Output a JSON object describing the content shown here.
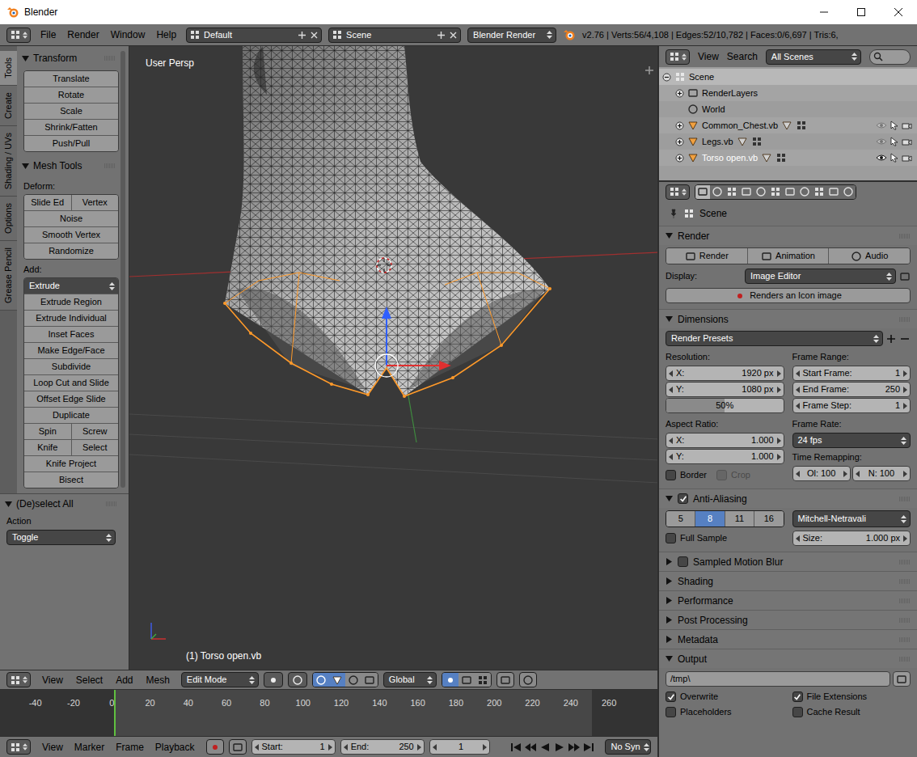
{
  "window": {
    "title": "Blender"
  },
  "info_header": {
    "menus": [
      "File",
      "Render",
      "Window",
      "Help"
    ],
    "layout": "Default",
    "scene": "Scene",
    "engine": "Blender Render",
    "stats": "v2.76 | Verts:56/4,108 | Edges:52/10,782 | Faces:0/6,697 | Tris:6,"
  },
  "tool_shelf": {
    "tabs": [
      {
        "label": "Tools",
        "selected": true
      },
      {
        "label": "Create",
        "selected": false
      },
      {
        "label": "Shading / UVs",
        "selected": false
      },
      {
        "label": "Options",
        "selected": false
      },
      {
        "label": "Grease Pencil",
        "selected": false
      }
    ],
    "panels": [
      {
        "title": "Transform",
        "expanded": true,
        "groups": [
          {
            "label": "",
            "rows": [
              {
                "kind": "button",
                "buttons": [
                  "Translate"
                ]
              },
              {
                "kind": "button",
                "buttons": [
                  "Rotate"
                ]
              },
              {
                "kind": "button",
                "buttons": [
                  "Scale"
                ]
              },
              {
                "kind": "button",
                "buttons": [
                  "Shrink/Fatten"
                ]
              },
              {
                "kind": "button",
                "buttons": [
                  "Push/Pull"
                ]
              }
            ]
          }
        ]
      },
      {
        "title": "Mesh Tools",
        "expanded": true,
        "groups": [
          {
            "label": "Deform:",
            "rows": [
              {
                "kind": "button",
                "buttons": [
                  "Slide Ed",
                  "Vertex"
                ]
              },
              {
                "kind": "button",
                "buttons": [
                  "Noise"
                ]
              },
              {
                "kind": "button",
                "buttons": [
                  "Smooth Vertex"
                ]
              },
              {
                "kind": "button",
                "buttons": [
                  "Randomize"
                ]
              }
            ]
          },
          {
            "label": "Add:",
            "rows": [
              {
                "kind": "menu",
                "buttons": [
                  "Extrude"
                ]
              },
              {
                "kind": "button",
                "buttons": [
                  "Extrude Region"
                ]
              },
              {
                "kind": "button",
                "buttons": [
                  "Extrude Individual"
                ]
              },
              {
                "kind": "button",
                "buttons": [
                  "Inset Faces"
                ]
              },
              {
                "kind": "button",
                "buttons": [
                  "Make Edge/Face"
                ]
              },
              {
                "kind": "button",
                "buttons": [
                  "Subdivide"
                ]
              },
              {
                "kind": "button",
                "buttons": [
                  "Loop Cut and Slide"
                ]
              },
              {
                "kind": "button",
                "buttons": [
                  "Offset Edge Slide"
                ]
              },
              {
                "kind": "button",
                "buttons": [
                  "Duplicate"
                ]
              },
              {
                "kind": "button",
                "buttons": [
                  "Spin",
                  "Screw"
                ]
              },
              {
                "kind": "button",
                "buttons": [
                  "Knife",
                  "Select"
                ]
              },
              {
                "kind": "button",
                "buttons": [
                  "Knife Project"
                ]
              },
              {
                "kind": "button",
                "buttons": [
                  "Bisect"
                ]
              }
            ]
          }
        ]
      }
    ],
    "operator": {
      "title": "(De)select All",
      "expanded": true,
      "label": "Action",
      "value": "Toggle"
    }
  },
  "viewport": {
    "view_name": "User Persp",
    "object_label": "(1) Torso open.vb"
  },
  "view3d_header": {
    "menus": [
      "View",
      "Select",
      "Add",
      "Mesh"
    ],
    "mode": "Edit Mode",
    "orientation": "Global"
  },
  "timeline": {
    "ruler": [
      "-40",
      "-20",
      "0",
      "20",
      "40",
      "60",
      "80",
      "100",
      "120",
      "140",
      "160",
      "180",
      "200",
      "220",
      "240",
      "260"
    ],
    "menus": [
      "View",
      "Marker",
      "Frame",
      "Playback"
    ],
    "start": {
      "label": "Start:",
      "value": "1"
    },
    "end": {
      "label": "End:",
      "value": "250"
    },
    "frame": "1",
    "sync": "No Syn"
  },
  "outliner": {
    "menus": [
      "View",
      "Search"
    ],
    "filter": "All Scenes",
    "items": [
      {
        "name": "Scene",
        "depth": 0,
        "kind": "scene",
        "expandable": true,
        "expanded": true,
        "selected": true,
        "active": false,
        "visible": true
      },
      {
        "name": "RenderLayers",
        "depth": 1,
        "kind": "renderlayers",
        "expandable": true,
        "expanded": false,
        "selected": false,
        "active": false,
        "visible": true
      },
      {
        "name": "World",
        "depth": 1,
        "kind": "world",
        "expandable": false,
        "expanded": false,
        "selected": false,
        "active": false,
        "visible": true
      },
      {
        "name": "Common_Chest.vb",
        "depth": 1,
        "kind": "object",
        "expandable": true,
        "expanded": false,
        "selected": false,
        "active": false,
        "visible": false
      },
      {
        "name": "Legs.vb",
        "depth": 1,
        "kind": "object",
        "expandable": true,
        "expanded": false,
        "selected": false,
        "active": false,
        "visible": false
      },
      {
        "name": "Torso open.vb",
        "depth": 1,
        "kind": "object",
        "expandable": true,
        "expanded": false,
        "selected": false,
        "active": true,
        "visible": true
      }
    ]
  },
  "properties": {
    "tabs": [
      {
        "selected": true
      },
      {
        "selected": false
      },
      {
        "selected": false
      },
      {
        "selected": false
      },
      {
        "selected": false
      },
      {
        "selected": false
      },
      {
        "selected": false
      },
      {
        "selected": false
      },
      {
        "selected": false
      },
      {
        "selected": false
      },
      {
        "selected": false
      }
    ],
    "context": "Scene",
    "render": {
      "title": "Render",
      "expanded": true,
      "buttons": [
        "Render",
        "Animation",
        "Audio"
      ],
      "display_label": "Display:",
      "display": "Image Editor",
      "icon_button": "Renders an Icon image"
    },
    "dimensions": {
      "title": "Dimensions",
      "expanded": true,
      "presets": "Render Presets",
      "resolution_label": "Resolution:",
      "resolution": [
        {
          "label": "X:",
          "value": "1920 px"
        },
        {
          "label": "Y:",
          "value": "1080 px"
        }
      ],
      "percentage": {
        "value": "50%",
        "level": 0.5
      },
      "aspect_label": "Aspect Ratio:",
      "aspect": [
        {
          "label": "X:",
          "value": "1.000"
        },
        {
          "label": "Y:",
          "value": "1.000"
        }
      ],
      "border": {
        "label": "Border",
        "checked": false,
        "disabled": false
      },
      "crop": {
        "label": "Crop",
        "checked": false,
        "disabled": true
      },
      "frame_range_label": "Frame Range:",
      "frame_range": [
        {
          "label": "Start Frame:",
          "value": "1"
        },
        {
          "label": "End Frame:",
          "value": "250"
        },
        {
          "label": "Frame Step:",
          "value": "1"
        }
      ],
      "frame_rate_label": "Frame Rate:",
      "frame_rate": "24 fps",
      "remap_label": "Time Remapping:",
      "remap": [
        {
          "label": "Ol:",
          "value": "100"
        },
        {
          "label": "N:",
          "value": "100"
        }
      ]
    },
    "anti_aliasing": {
      "title": "Anti-Aliasing",
      "expanded": true,
      "enabled": true,
      "samples": [
        {
          "label": "5",
          "selected": false
        },
        {
          "label": "8",
          "selected": true
        },
        {
          "label": "11",
          "selected": false
        },
        {
          "label": "16",
          "selected": false
        }
      ],
      "filter": "Mitchell-Netravali",
      "full_sample": {
        "label": "Full Sample",
        "checked": false,
        "disabled": false
      },
      "size": {
        "label": "Size:",
        "value": "1.000 px"
      }
    },
    "collapsed_panels": [
      {
        "title": "Sampled Motion Blur",
        "kind": "checkbox",
        "checked": false,
        "expanded": false
      },
      {
        "title": "Shading",
        "kind": "plain",
        "checked": false,
        "expanded": false
      },
      {
        "title": "Performance",
        "kind": "plain",
        "checked": false,
        "expanded": false
      },
      {
        "title": "Post Processing",
        "kind": "plain",
        "checked": false,
        "expanded": false
      },
      {
        "title": "Metadata",
        "kind": "plain",
        "checked": false,
        "expanded": false
      }
    ],
    "output": {
      "title": "Output",
      "expanded": true,
      "path": "/tmp\\",
      "options": [
        {
          "label": "Overwrite",
          "checked": true,
          "disabled": false
        },
        {
          "label": "File Extensions",
          "checked": true,
          "disabled": false
        },
        {
          "label": "Placeholders",
          "checked": false,
          "disabled": false
        },
        {
          "label": "Cache Result",
          "checked": false,
          "disabled": false
        }
      ]
    }
  }
}
